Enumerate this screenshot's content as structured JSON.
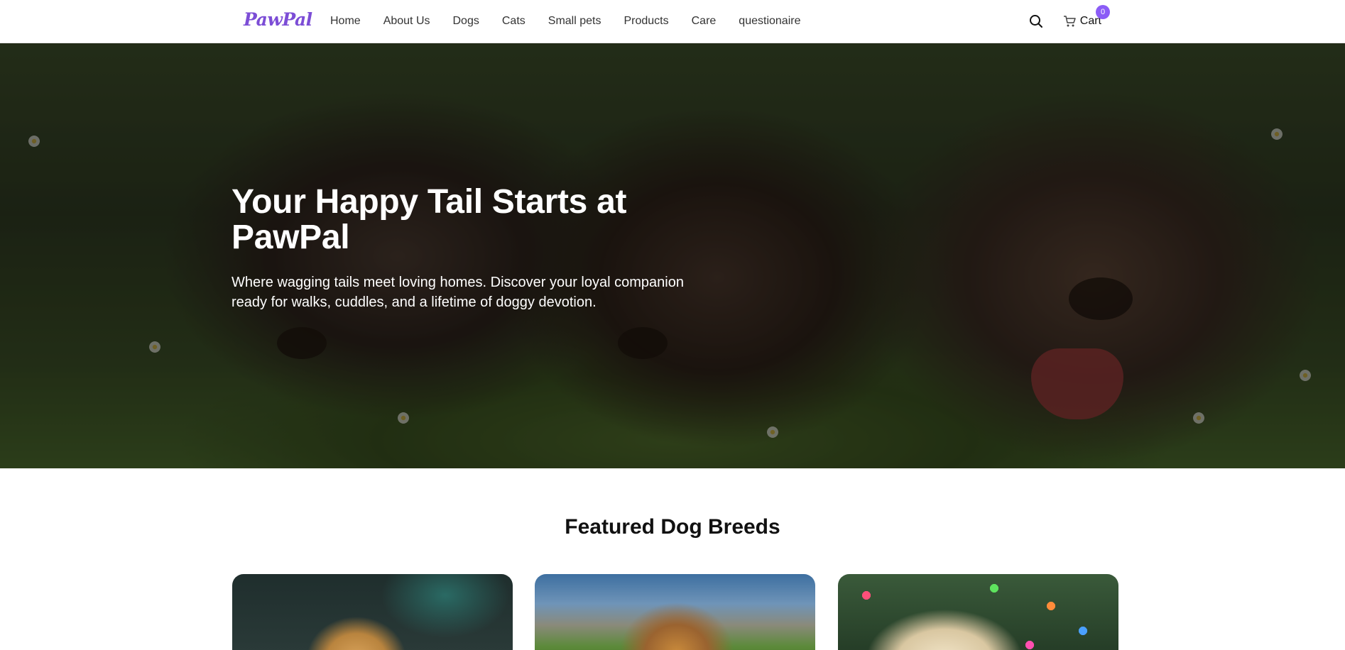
{
  "brand": {
    "logo_text": "PawPal",
    "accent_color": "#8b5cf6",
    "logo_color": "#7c4dd6"
  },
  "nav": {
    "links": [
      "Home",
      "About Us",
      "Dogs",
      "Cats",
      "Small pets",
      "Products",
      "Care",
      "questionaire"
    ],
    "search_icon": "search-icon",
    "cart_icon": "cart-icon",
    "cart_label": "Cart",
    "cart_count": "0"
  },
  "hero": {
    "title": "Your Happy Tail Starts at PawPal",
    "subtitle": "Where wagging tails meet loving homes. Discover your loyal companion ready for walks, cuddles, and a lifetime of doggy devotion."
  },
  "featured": {
    "title": "Featured Dog Breeds",
    "cards": [
      {
        "image": "golden-retriever-photo"
      },
      {
        "image": "german-shepherd-photo"
      },
      {
        "image": "labrador-puppy-photo"
      }
    ]
  }
}
